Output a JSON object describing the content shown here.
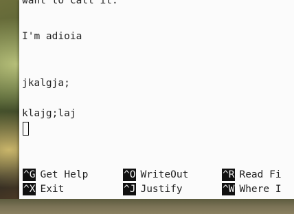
{
  "editor": {
    "lines": {
      "top_partial": "want to call it.",
      "line1": "I'm adioia",
      "line2": "jkalgja;",
      "line3": "klajg;laj"
    }
  },
  "shortcuts": [
    {
      "key": "^G",
      "label": "Get Help"
    },
    {
      "key": "^O",
      "label": "WriteOut"
    },
    {
      "key": "^R",
      "label": "Read Fi"
    },
    {
      "key": "^X",
      "label": "Exit"
    },
    {
      "key": "^J",
      "label": "Justify"
    },
    {
      "key": "^W",
      "label": "Where I"
    }
  ]
}
